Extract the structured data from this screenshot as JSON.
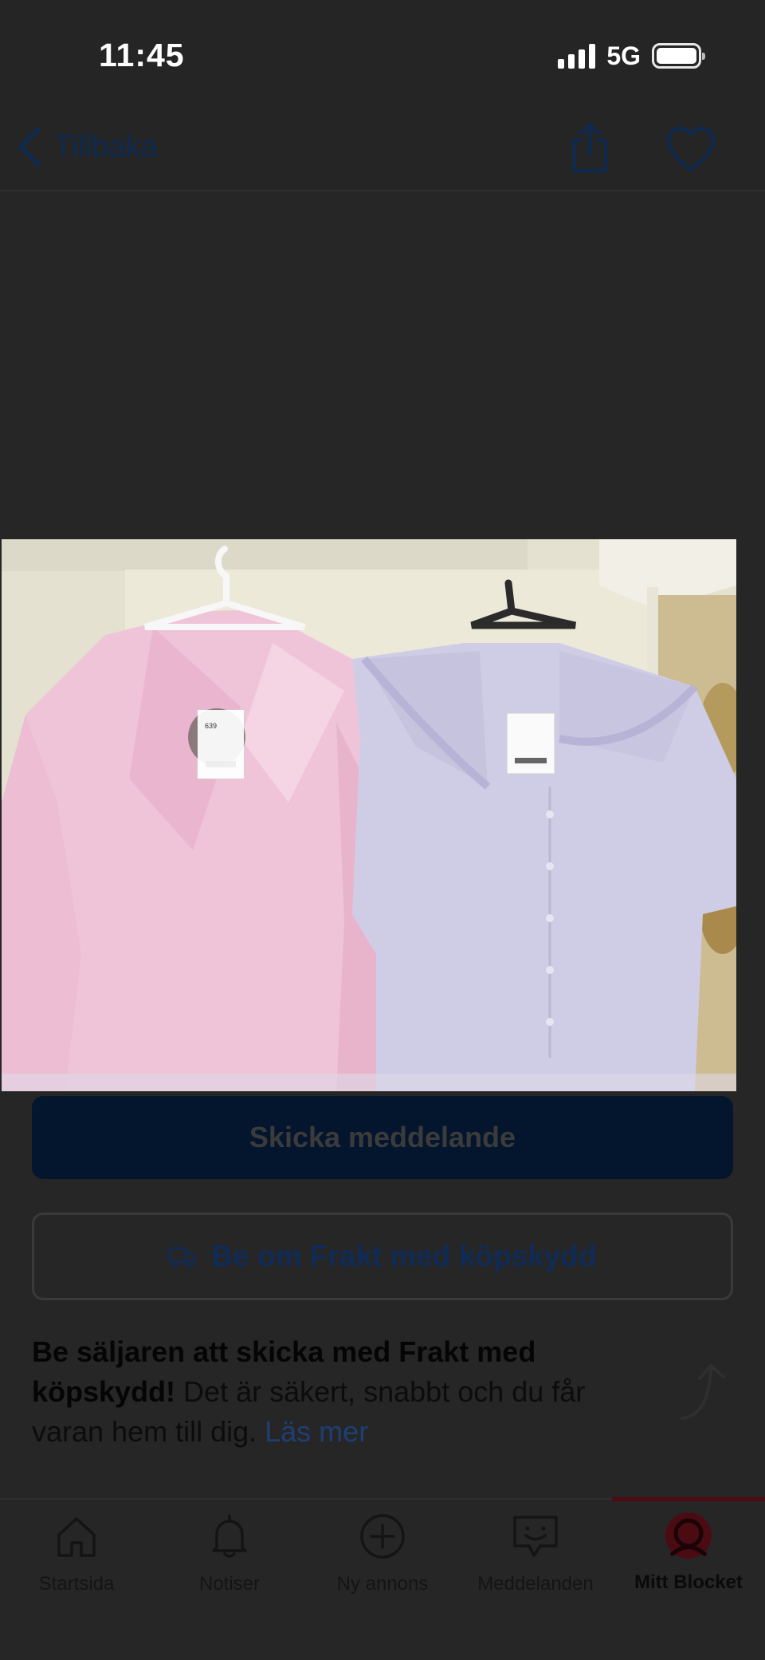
{
  "status_bar": {
    "time": "11:45",
    "network": "5G"
  },
  "nav": {
    "back_label": "Tillbaka"
  },
  "actions": {
    "send_message": "Skicka meddelande",
    "request_shipping": "Be om Frakt med köpskydd"
  },
  "promo": {
    "bold_text": "Be säljaren att skicka med Frakt med köpskydd!",
    "text": " Det är säkert, snabbt och du får varan hem till dig. ",
    "link": "Läs mer"
  },
  "tabs": [
    {
      "label": "Startsida",
      "icon": "home-icon"
    },
    {
      "label": "Notiser",
      "icon": "bell-icon"
    },
    {
      "label": "Ny annons",
      "icon": "plus-circle-icon"
    },
    {
      "label": "Meddelanden",
      "icon": "chat-icon"
    },
    {
      "label": "Mitt Blocket",
      "icon": "avatar-icon",
      "active": true
    }
  ],
  "colors": {
    "primary_button": "#04152e",
    "link": "#1e3f74",
    "active_tab": "#4f0a12",
    "overlay_background": "#262626"
  }
}
